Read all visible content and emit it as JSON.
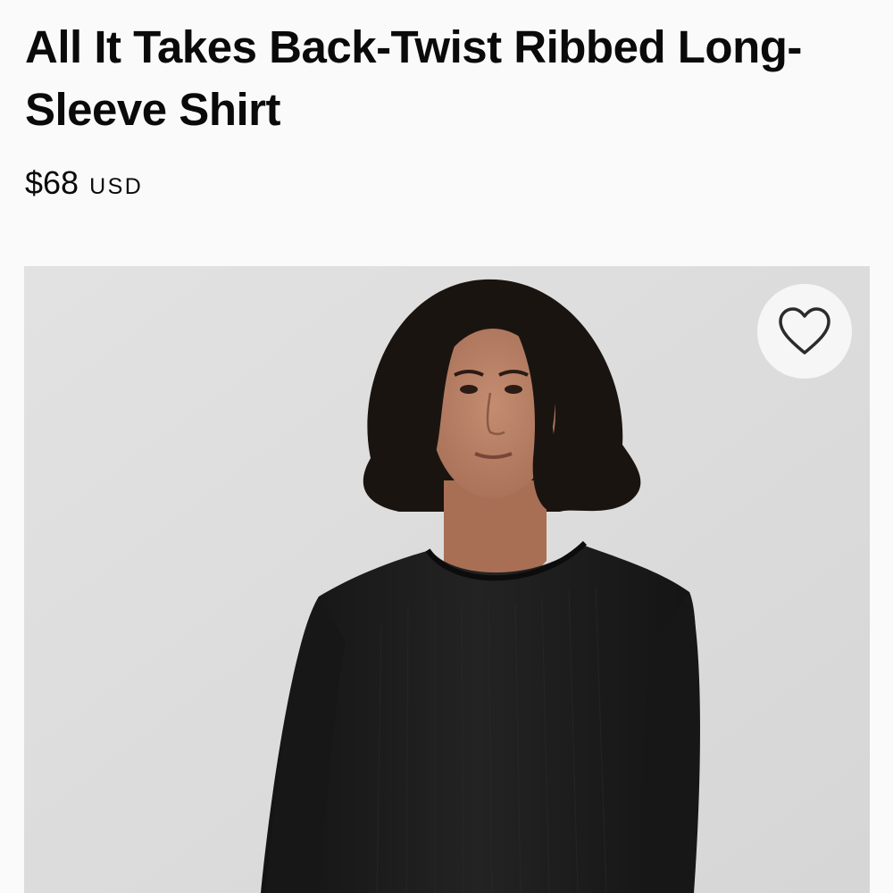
{
  "product": {
    "title": "All It Takes Back-Twist Ribbed Long-Sleeve Shirt",
    "price": "$68",
    "currency": "USD"
  },
  "image": {
    "alt": "Model wearing a black ribbed long-sleeve shirt",
    "background_color": "#dcdcdc",
    "garment_color": "#1c1c1c",
    "hair_color": "#1a1411",
    "skin_color": "#b98267"
  },
  "wishlist": {
    "icon": "heart-outline-icon",
    "aria_label": "Add to wishlist"
  }
}
